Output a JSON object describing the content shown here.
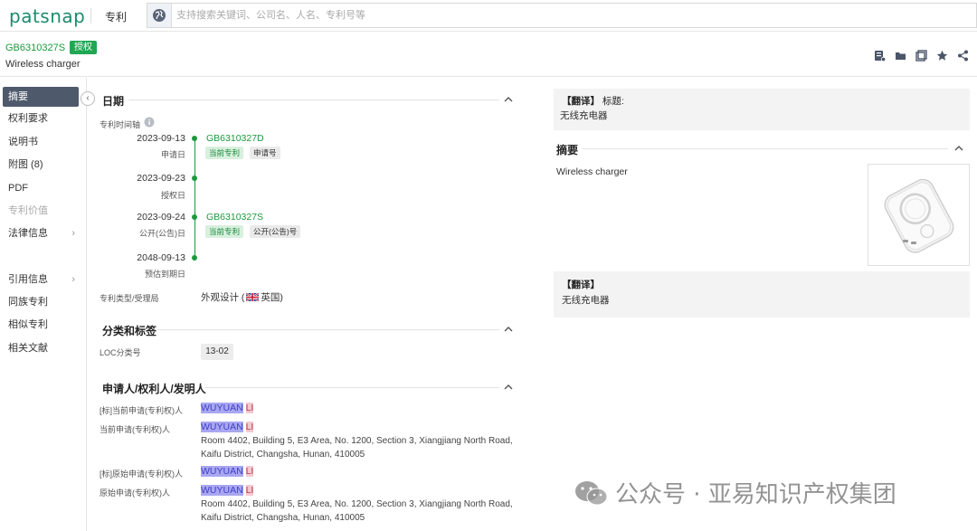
{
  "app": {
    "logo": "patsnap",
    "module": "专利"
  },
  "search": {
    "placeholder": "支持搜索关键词、公司名、人名、专利号等"
  },
  "patent": {
    "number": "GB6310327S",
    "status_badge": "授权",
    "title": "Wireless charger"
  },
  "header_actions": [
    "save-to-folder-icon",
    "folder-icon",
    "compare-icon",
    "star-icon",
    "share-icon"
  ],
  "sidebar": {
    "items": [
      {
        "label": "摘要",
        "active": true
      },
      {
        "label": "权利要求"
      },
      {
        "label": "说明书"
      },
      {
        "label": "附图 (8)"
      },
      {
        "label": "PDF"
      },
      {
        "label": "专利价值",
        "disabled": true
      },
      {
        "label": "法律信息",
        "chevron": "›"
      },
      {
        "label": "引用信息",
        "chevron": "›"
      },
      {
        "label": "同族专利"
      },
      {
        "label": "相似专利"
      },
      {
        "label": "相关文献"
      }
    ],
    "collapse": "‹"
  },
  "dates": {
    "section_title": "日期",
    "timeline_label": "专利时间轴",
    "events": [
      {
        "date": "2023-09-13",
        "label": "申请日",
        "link": "GB6310327D",
        "tags": [
          "当前专利",
          "申请号"
        ]
      },
      {
        "date": "2023-09-23",
        "label": "授权日"
      },
      {
        "date": "2023-09-24",
        "label": "公开(公告)日",
        "link": "GB6310327S",
        "tags": [
          "当前专利",
          "公开(公告)号"
        ]
      },
      {
        "date": "2048-09-13",
        "label": "预估到期日"
      }
    ],
    "type_label": "专利类型/受理局",
    "type_value": "外观设计 (",
    "country": "英国",
    "type_close": ")"
  },
  "classification": {
    "section_title": "分类和标签",
    "loc_label": "LOC分类号",
    "loc_value": "13-02"
  },
  "parties": {
    "section_title": "申请人/权利人/发明人",
    "rows": [
      {
        "label": "[标]当前申请(专利权)人",
        "name_a": "WUYUAN",
        "name_b": "LI"
      },
      {
        "label": "当前申请(专利权)人",
        "name_a": "WUYUAN",
        "name_b": "LI",
        "address_1": "Room 4402, Building 5, E3 Area, No. 1200, Section 3, Xiangjiang North Road,",
        "address_2": "Kaifu District, Changsha, Hunan, 410005"
      },
      {
        "label": "[标]原始申请(专利权)人",
        "name_a": "WUYUAN",
        "name_b": "LI"
      },
      {
        "label": "原始申请(专利权)人",
        "name_a": "WUYUAN",
        "name_b": "LI",
        "address_1": "Room 4402, Building 5, E3 Area, No. 1200, Section 3, Xiangjiang North Road,",
        "address_2": "Kaifu District, Changsha, Hunan, 410005"
      }
    ]
  },
  "right": {
    "title_translation": {
      "tag": "【翻译】",
      "label": "标题:",
      "text": "无线充电器"
    },
    "abstract": {
      "section_title": "摘要",
      "text": "Wireless charger"
    },
    "abstract_translation": {
      "tag": "【翻译】",
      "text": "无线充电器"
    }
  },
  "watermark": {
    "text": "公众号 · 亚易知识产权集团"
  },
  "colors": {
    "brand": "#1b8b6e",
    "link_green": "#1a9a3c",
    "sidebar_active": "#4e5a6b"
  }
}
